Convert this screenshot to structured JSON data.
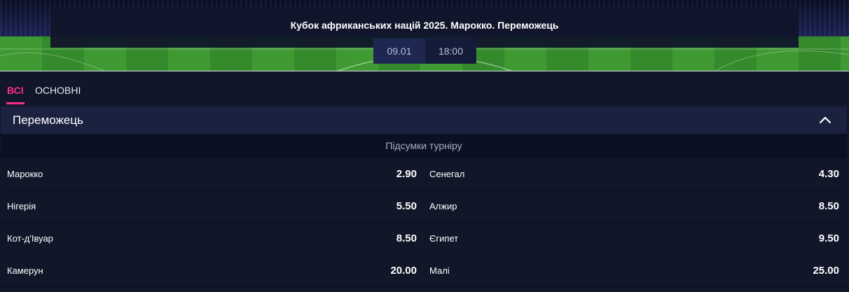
{
  "event": {
    "title": "Кубок африканських націй 2025. Марокко. Переможець",
    "date": "09.01",
    "time": "18:00"
  },
  "tabs": [
    {
      "label": "ВСІ",
      "active": true
    },
    {
      "label": "ОСНОВНІ",
      "active": false
    }
  ],
  "market": {
    "title": "Переможець",
    "subtitle": "Підсумки турніру",
    "expanded": true,
    "rows": [
      {
        "left": {
          "team": "Марокко",
          "odds": "2.90"
        },
        "right": {
          "team": "Сенегал",
          "odds": "4.30"
        }
      },
      {
        "left": {
          "team": "Нігерія",
          "odds": "5.50"
        },
        "right": {
          "team": "Алжир",
          "odds": "8.50"
        }
      },
      {
        "left": {
          "team": "Кот-д'Івуар",
          "odds": "8.50"
        },
        "right": {
          "team": "Єгипет",
          "odds": "9.50"
        }
      },
      {
        "left": {
          "team": "Камерун",
          "odds": "20.00"
        },
        "right": {
          "team": "Малі",
          "odds": "25.00"
        }
      }
    ]
  },
  "colors": {
    "accent": "#ff2d87",
    "background": "#111629",
    "header": "#1b2240",
    "subheader": "#0b1023"
  },
  "icons": {
    "collapse": "chevron-up-icon"
  }
}
